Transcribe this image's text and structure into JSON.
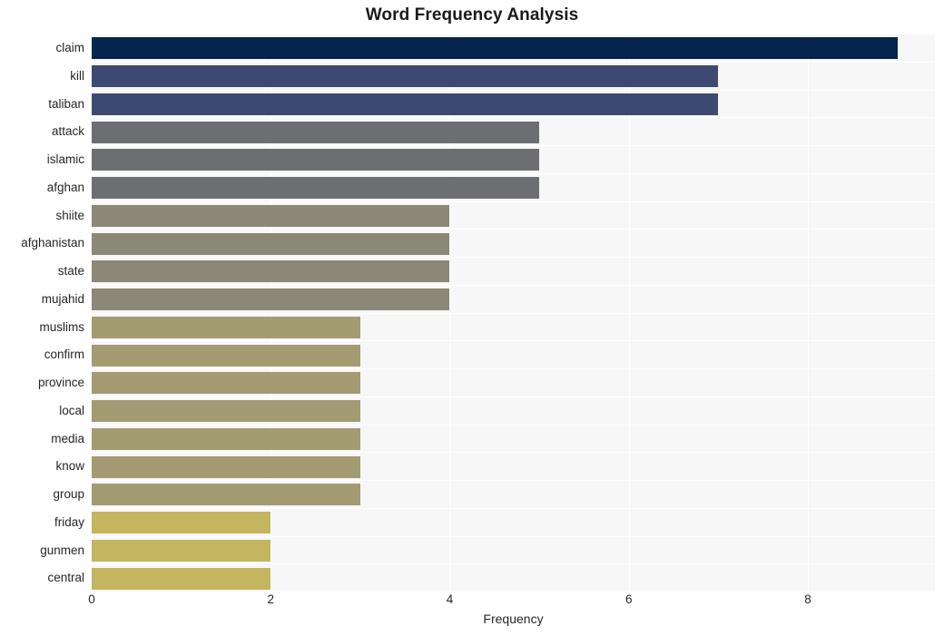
{
  "chart_data": {
    "type": "bar",
    "orientation": "horizontal",
    "title": "Word Frequency Analysis",
    "xlabel": "Frequency",
    "ylabel": "",
    "xlim": [
      0,
      9.42
    ],
    "xticks": [
      0,
      2,
      4,
      6,
      8
    ],
    "grid": "vertical-white-on-light-gray",
    "legend": "none",
    "categories": [
      "claim",
      "kill",
      "taliban",
      "attack",
      "islamic",
      "afghan",
      "shiite",
      "afghanistan",
      "state",
      "mujahid",
      "muslims",
      "confirm",
      "province",
      "local",
      "media",
      "know",
      "group",
      "friday",
      "gunmen",
      "central"
    ],
    "values": [
      9,
      7,
      7,
      5,
      5,
      5,
      4,
      4,
      4,
      4,
      3,
      3,
      3,
      3,
      3,
      3,
      3,
      2,
      2,
      2
    ],
    "colors": [
      "#05244f",
      "#3c4a72",
      "#3c4a72",
      "#6d6e71",
      "#6d6e71",
      "#6d6e71",
      "#8b8878",
      "#8b8878",
      "#8b8878",
      "#8b8878",
      "#a39b72",
      "#a39b72",
      "#a39b72",
      "#a39b72",
      "#a39b72",
      "#a39b72",
      "#a39b72",
      "#c4b55f",
      "#c4b55f",
      "#c4b55f"
    ],
    "plot_background": "#f7f7f7",
    "figure_background": "#ffffff",
    "gridline_color": "#ffffff"
  }
}
